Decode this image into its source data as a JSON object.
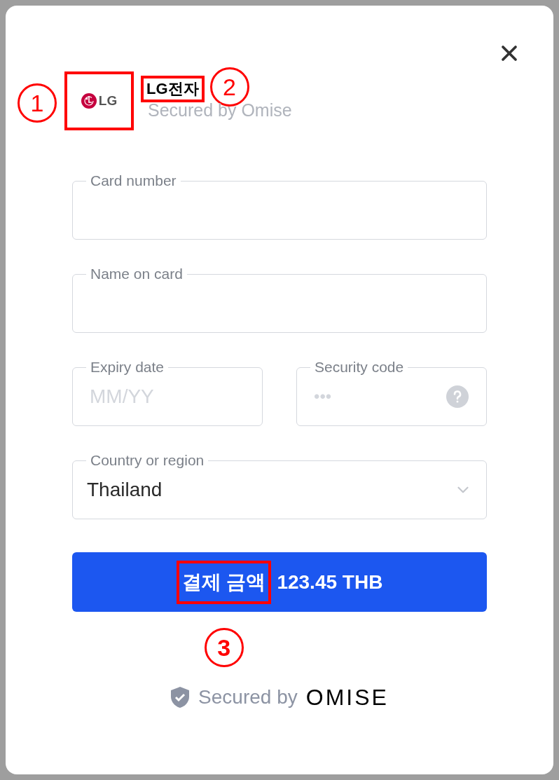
{
  "merchant": {
    "logo_text": "LG",
    "logo_annotation": "1",
    "name": "LG전자",
    "name_annotation": "2",
    "subtitle": "Secured by Omise"
  },
  "rows": [
    [
      {
        "kind": "text",
        "label": "Card number"
      }
    ],
    [
      {
        "kind": "text",
        "label": "Name on card"
      }
    ],
    [
      {
        "kind": "text",
        "label": "Expiry date",
        "placeholder": "MM/YY"
      },
      {
        "kind": "cvv",
        "label": "Security code",
        "placeholder": "•••"
      }
    ],
    [
      {
        "kind": "select",
        "label": "Country or region",
        "value": "Thailand"
      }
    ]
  ],
  "pay_button": {
    "label": "결제 금액",
    "amount": "123.45 THB",
    "annotation": "3"
  },
  "footer": {
    "text": "Secured by",
    "brand": "OMISE"
  }
}
